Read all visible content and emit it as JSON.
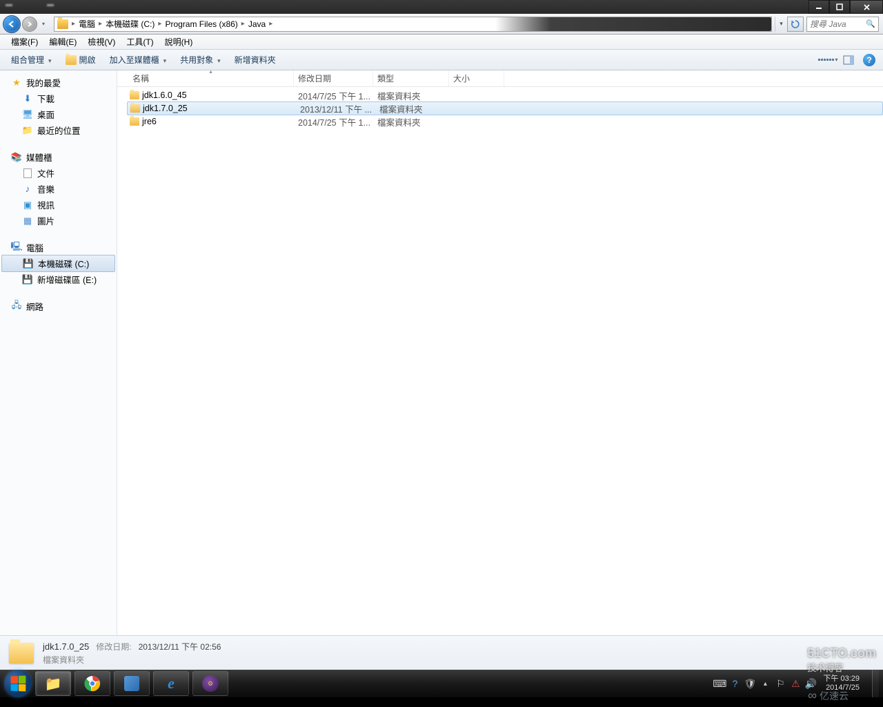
{
  "titlebar": {
    "blurred_controls": [
      "",
      "",
      ""
    ]
  },
  "nav": {
    "breadcrumbs": [
      "電腦",
      "本機磁碟 (C:)",
      "Program Files (x86)",
      "Java"
    ],
    "search_placeholder": "搜尋 Java"
  },
  "menubar": {
    "items": [
      "檔案(F)",
      "編輯(E)",
      "檢視(V)",
      "工具(T)",
      "說明(H)"
    ]
  },
  "toolbar": {
    "organize": "組合管理",
    "open": "開啟",
    "include": "加入至媒體櫃",
    "share": "共用對象",
    "newfolder": "新增資料夾"
  },
  "columns": {
    "name": "名稱",
    "date": "修改日期",
    "type": "類型",
    "size": "大小"
  },
  "sidebar": {
    "favorites": {
      "label": "我的最愛",
      "items": [
        "下載",
        "桌面",
        "最近的位置"
      ]
    },
    "libraries": {
      "label": "媒體櫃",
      "items": [
        "文件",
        "音樂",
        "視訊",
        "圖片"
      ]
    },
    "computer": {
      "label": "電腦",
      "items": [
        "本機磁碟 (C:)",
        "新增磁碟區 (E:)"
      ]
    },
    "network": {
      "label": "網路"
    }
  },
  "files": [
    {
      "name": "jdk1.6.0_45",
      "date": "2014/7/25 下午 1...",
      "type": "檔案資料夾",
      "size": "",
      "selected": false
    },
    {
      "name": "jdk1.7.0_25",
      "date": "2013/12/11 下午 ...",
      "type": "檔案資料夾",
      "size": "",
      "selected": true
    },
    {
      "name": "jre6",
      "date": "2014/7/25 下午 1...",
      "type": "檔案資料夾",
      "size": "",
      "selected": false
    }
  ],
  "details": {
    "name": "jdk1.7.0_25",
    "type": "檔案資料夾",
    "date_label": "修改日期:",
    "date": "2013/12/11 下午 02:56"
  },
  "clock": {
    "time": "下午 03:29",
    "date": "2014/7/25"
  },
  "watermarks": {
    "w1a": "51CTO.com",
    "w1b": "技术博客",
    "w2": "亿速云"
  }
}
